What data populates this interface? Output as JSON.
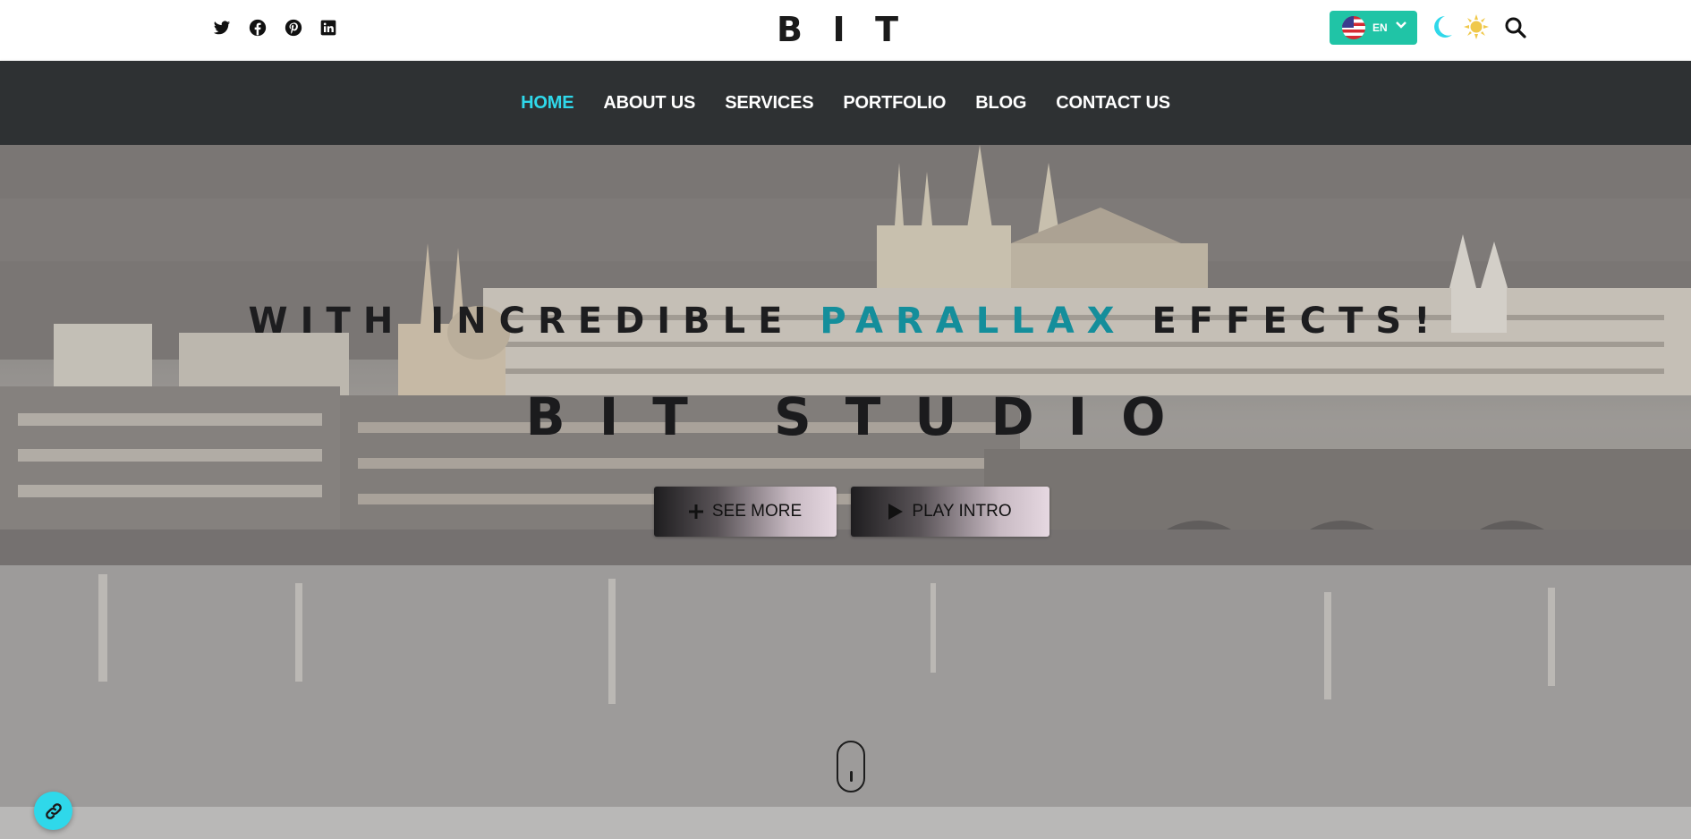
{
  "social": [
    {
      "name": "twitter-icon"
    },
    {
      "name": "facebook-icon"
    },
    {
      "name": "pinterest-icon"
    },
    {
      "name": "linkedin-icon"
    }
  ],
  "logo": {
    "letters": [
      "B",
      "I",
      "T"
    ]
  },
  "language": {
    "code": "EN",
    "flag": "us-flag-icon",
    "accent": "#20c4a6"
  },
  "theme": {
    "dark_icon": "moon-icon",
    "light_icon": "sun-icon",
    "moon_color": "#2fd8ea",
    "sun_color": "#f0c84a"
  },
  "nav": {
    "items": [
      {
        "label": "HOME",
        "active": true
      },
      {
        "label": "ABOUT US"
      },
      {
        "label": "SERVICES"
      },
      {
        "label": "PORTFOLIO"
      },
      {
        "label": "BLOG"
      },
      {
        "label": "CONTACT US"
      }
    ],
    "active_color": "#2fd8ea"
  },
  "hero": {
    "tagline_before": "WITH INCREDIBLE ",
    "tagline_accent": "PARALLAX",
    "tagline_after": " EFFECTS!",
    "title": "BIT STUDIO",
    "see_more": "SEE MORE",
    "play_intro": "PLAY INTRO"
  }
}
